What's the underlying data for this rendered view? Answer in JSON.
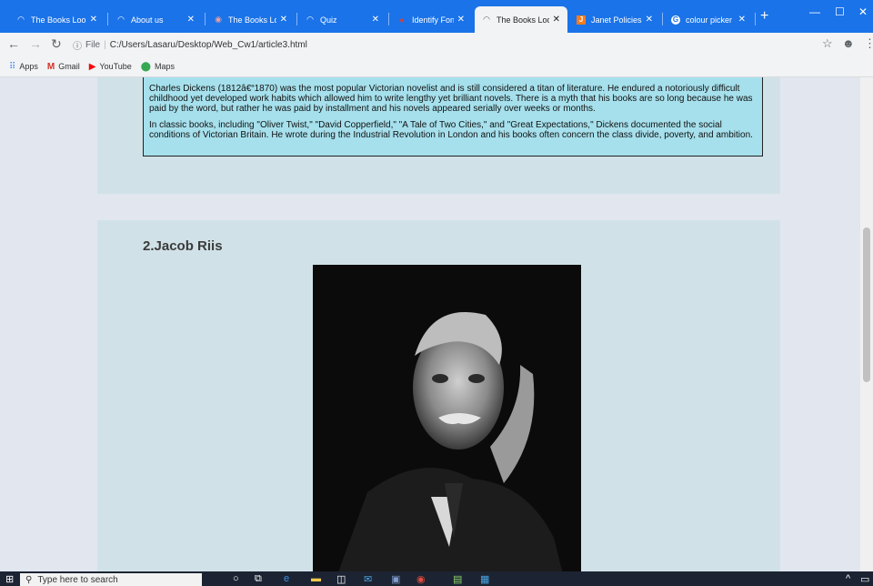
{
  "browser": {
    "tabs": [
      {
        "title": "The Books Look-H",
        "active": false
      },
      {
        "title": "About us",
        "active": false
      },
      {
        "title": "The Books Look-H",
        "active": false
      },
      {
        "title": "Quiz",
        "active": false
      },
      {
        "title": "Identify Fonts - Th",
        "active": false
      },
      {
        "title": "The Books Look-H",
        "active": true
      },
      {
        "title": "Janet Policies and",
        "active": false
      },
      {
        "title": "colour picker - Go",
        "active": false
      }
    ],
    "new_tab": "+",
    "address_label": "File",
    "address": "C:/Users/Lasaru/Desktop/Web_Cw1/article3.html",
    "bookmarks": [
      "Apps",
      "Gmail",
      "YouTube",
      "Maps"
    ]
  },
  "page": {
    "section1": {
      "paragraphs": [
        "Charles Dickens (1812â€“1870) was the most popular Victorian novelist and is still considered a titan of literature. He endured a notoriously difficult childhood yet developed work habits which allowed him to write lengthy yet brilliant novels. There is a myth that his books are so long because he was paid by the word, but rather he was paid by installment and his novels appeared serially over weeks or months.",
        "In classic books, including \"Oliver Twist,\" \"David Copperfield,\" \"A Tale of Two Cities,\" and \"Great Expectations,\" Dickens documented the social conditions of Victorian Britain. He wrote during the Industrial Revolution in London and his books often concern the class divide, poverty, and ambition."
      ]
    },
    "section2": {
      "heading": "2.Jacob Riis"
    }
  },
  "taskbar": {
    "search_placeholder": "Type here to search"
  },
  "colors": {
    "tabstrip": "#1a73e8",
    "card": "#d0e2e8",
    "textbox": "#a6e0ec",
    "page_bg": "#e1e6ef"
  }
}
